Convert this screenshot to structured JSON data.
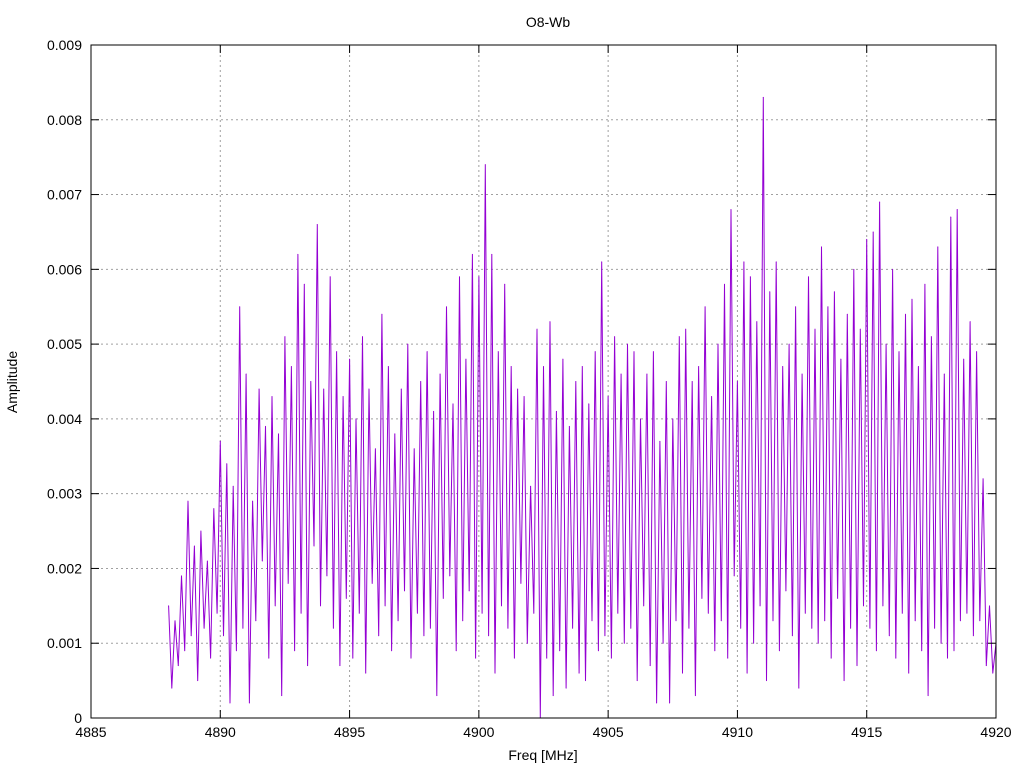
{
  "chart_data": {
    "type": "line",
    "title": "O8-Wb",
    "xlabel": "Freq [MHz]",
    "ylabel": "Amplitude",
    "xlim": [
      4885,
      4920
    ],
    "ylim": [
      0,
      0.009
    ],
    "xticks": [
      "4885",
      "4890",
      "4895",
      "4900",
      "4905",
      "4910",
      "4915",
      "4920"
    ],
    "xtick_values": [
      4885,
      4890,
      4895,
      4900,
      4905,
      4910,
      4915,
      4920
    ],
    "yticks": [
      "0",
      "0.001",
      "0.002",
      "0.003",
      "0.004",
      "0.005",
      "0.006",
      "0.007",
      "0.008",
      "0.009"
    ],
    "ytick_values": [
      0,
      0.001,
      0.002,
      0.003,
      0.004,
      0.005,
      0.006,
      0.007,
      0.008,
      0.009
    ],
    "grid": true,
    "legend": "none",
    "series": [
      {
        "name": "O8-Wb",
        "color": "#9400d3",
        "x_start": 4888,
        "x_step": 0.125,
        "values": [
          0.0015,
          0.0004,
          0.0013,
          0.0007,
          0.0019,
          0.0009,
          0.0029,
          0.0011,
          0.0023,
          0.0005,
          0.0025,
          0.0012,
          0.0021,
          0.0008,
          0.0028,
          0.0014,
          0.0037,
          0.0011,
          0.0034,
          0.0002,
          0.0031,
          0.0009,
          0.0055,
          0.0012,
          0.0046,
          0.0002,
          0.0029,
          0.0013,
          0.0044,
          0.0021,
          0.0039,
          0.0008,
          0.0043,
          0.0015,
          0.0038,
          0.0003,
          0.0051,
          0.0018,
          0.0047,
          0.0009,
          0.0062,
          0.0014,
          0.0058,
          0.0007,
          0.0045,
          0.0023,
          0.0066,
          0.0015,
          0.0044,
          0.0019,
          0.0059,
          0.0012,
          0.0049,
          0.0007,
          0.0043,
          0.0016,
          0.0048,
          0.0008,
          0.004,
          0.0014,
          0.0051,
          0.0006,
          0.0044,
          0.0018,
          0.0036,
          0.0011,
          0.0054,
          0.0015,
          0.0047,
          0.0009,
          0.0038,
          0.0013,
          0.0044,
          0.0017,
          0.005,
          0.0008,
          0.0036,
          0.0014,
          0.0045,
          0.0011,
          0.0049,
          0.0012,
          0.0041,
          0.0003,
          0.0046,
          0.0016,
          0.0055,
          0.0019,
          0.0042,
          0.0009,
          0.0059,
          0.0013,
          0.0048,
          0.0017,
          0.0062,
          0.0008,
          0.0059,
          0.0014,
          0.0074,
          0.0011,
          0.0062,
          0.0006,
          0.0049,
          0.0015,
          0.0058,
          0.0012,
          0.0047,
          0.0008,
          0.0044,
          0.0018,
          0.0043,
          0.001,
          0.0031,
          0.0014,
          0.0052,
          0.0,
          0.0047,
          0.0008,
          0.0053,
          0.0003,
          0.0041,
          0.0009,
          0.0048,
          0.0004,
          0.0039,
          0.0012,
          0.0045,
          0.0006,
          0.0047,
          0.0005,
          0.0042,
          0.0013,
          0.0049,
          0.0009,
          0.0061,
          0.0011,
          0.0043,
          0.0008,
          0.0051,
          0.0014,
          0.0046,
          0.001,
          0.005,
          0.0012,
          0.0049,
          0.0005,
          0.004,
          0.0015,
          0.0046,
          0.0007,
          0.0049,
          0.0002,
          0.0037,
          0.001,
          0.0045,
          0.0002,
          0.004,
          0.0013,
          0.0051,
          0.0006,
          0.0052,
          0.0012,
          0.0045,
          0.0003,
          0.0047,
          0.0016,
          0.0055,
          0.0014,
          0.0043,
          0.0009,
          0.005,
          0.0013,
          0.0058,
          0.0008,
          0.0068,
          0.0019,
          0.0045,
          0.0012,
          0.0061,
          0.0006,
          0.0059,
          0.001,
          0.0053,
          0.0015,
          0.0083,
          0.0005,
          0.0057,
          0.0013,
          0.0061,
          0.0009,
          0.0047,
          0.0017,
          0.005,
          0.0011,
          0.0055,
          0.0004,
          0.0046,
          0.0014,
          0.0059,
          0.0012,
          0.0052,
          0.001,
          0.0063,
          0.0013,
          0.0055,
          0.0008,
          0.0057,
          0.0016,
          0.0048,
          0.0005,
          0.0054,
          0.0012,
          0.006,
          0.0007,
          0.0052,
          0.0015,
          0.0064,
          0.0012,
          0.0065,
          0.0009,
          0.0069,
          0.0015,
          0.005,
          0.0011,
          0.006,
          0.0008,
          0.0049,
          0.0014,
          0.0054,
          0.0006,
          0.0056,
          0.0013,
          0.0047,
          0.0009,
          0.0058,
          0.0003,
          0.0051,
          0.0012,
          0.0063,
          0.001,
          0.0046,
          0.0008,
          0.0067,
          0.0009,
          0.0068,
          0.0013,
          0.0048,
          0.0014,
          0.0053,
          0.0011,
          0.0049,
          0.0013,
          0.0032,
          0.0007,
          0.0015,
          0.0006,
          0.001
        ]
      }
    ]
  }
}
